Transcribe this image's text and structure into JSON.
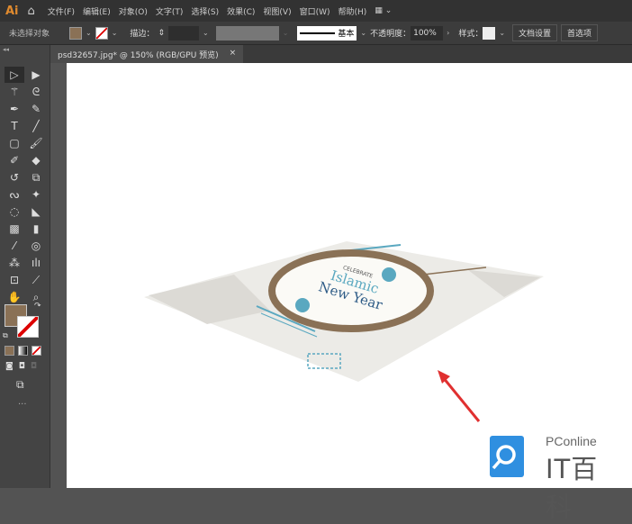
{
  "app": {
    "logo": "Ai"
  },
  "menu": [
    "文件(F)",
    "编辑(E)",
    "对象(O)",
    "文字(T)",
    "选择(S)",
    "效果(C)",
    "视图(V)",
    "窗口(W)",
    "帮助(H)"
  ],
  "control": {
    "selection": "未选择对象",
    "stroke_label": "描边：",
    "stroke_style": "基本",
    "opacity_label": "不透明度：",
    "opacity": "100%",
    "style_label": "样式：",
    "doc_setup": "文档设置",
    "prefs": "首选项",
    "fill_color": "#8a7156"
  },
  "tab": {
    "title": "psd32657.jpg* @ 150% (RGB/GPU 预览)",
    "close": "×"
  },
  "poster": {
    "celebrate": "CELEBRATE",
    "line1": "Islamic",
    "line2": "New Year"
  },
  "watermark": {
    "brand": "PConline",
    "name": "IT百科"
  },
  "colors": {
    "arrow": "#e03030",
    "teal": "#5aa8c0",
    "frame": "#8a7156"
  }
}
